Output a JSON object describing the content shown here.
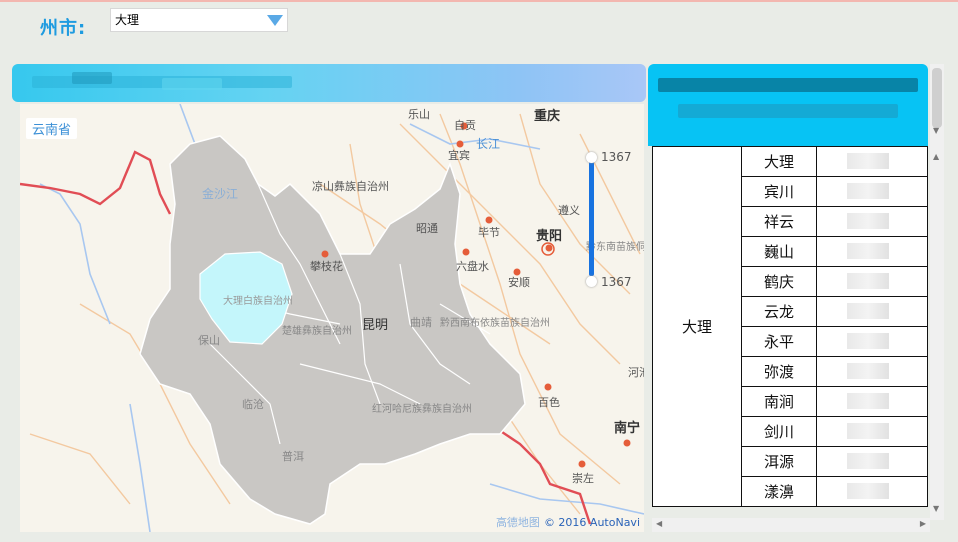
{
  "filter": {
    "label": "州市:",
    "selected": "大理"
  },
  "map": {
    "province_label": "云南省",
    "slider_max": "1367",
    "slider_min": "1367",
    "credit_logo": "高德地图",
    "credit": "© 2016 AutoNavi",
    "highlight_label": "大理白族自治州",
    "labels": {
      "leshan": "乐山",
      "chongqing": "重庆",
      "zigong": "自贡",
      "yibin": "宜宾",
      "changjiang": "长江",
      "jinshajiang": "金沙江",
      "liangshan": "凉山彝族自治州",
      "zunyi": "遵义",
      "bijie": "毕节",
      "guiyang": "贵阳",
      "zhaotong": "昭通",
      "panzhihua": "攀枝花",
      "qiandongnan": "黔东南苗族侗族自治州",
      "liupanshui": "六盘水",
      "anshun": "安顺",
      "kunming": "昆明",
      "qujing": "曲靖",
      "qianxinan": "黔西南布依族苗族自治州",
      "chuxiong": "楚雄彝族自治州",
      "baoshan": "保山",
      "hechi": "河池",
      "baise": "百色",
      "honghe": "红河哈尼族彝族自治州",
      "lincang": "临沧",
      "puer": "普洱",
      "nanning": "南宁",
      "chongzuo": "崇左"
    },
    "colors": {
      "province_fill": "#c9c7c4",
      "highlight_fill": "#c4f6fb",
      "border_red": "#e14d55"
    }
  },
  "table": {
    "group": "大理",
    "rows": [
      "大理",
      "宾川",
      "祥云",
      "巍山",
      "鹤庆",
      "云龙",
      "永平",
      "弥渡",
      "南涧",
      "剑川",
      "洱源",
      "漾濞"
    ]
  },
  "colors": {
    "title_gradient_start": "#36c8ee",
    "right_header": "#07c3f4",
    "label_blue": "#1e9be0"
  }
}
